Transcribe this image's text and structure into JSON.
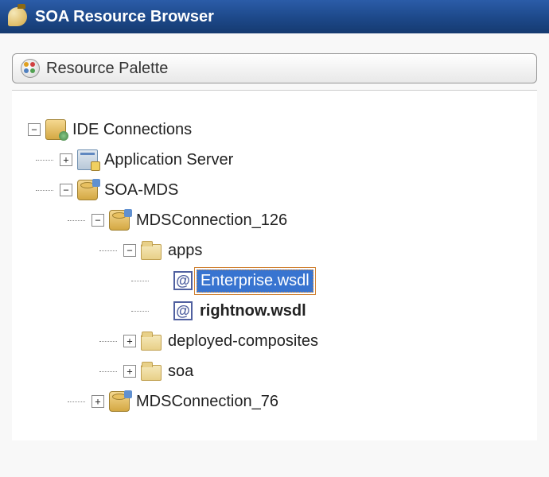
{
  "titlebar": {
    "title": "SOA Resource Browser"
  },
  "palette": {
    "label": "Resource Palette"
  },
  "tree": {
    "root": {
      "label": "IDE Connections",
      "children": [
        {
          "label": "Application Server"
        },
        {
          "label": "SOA-MDS",
          "children": [
            {
              "label": "MDSConnection_126",
              "children": [
                {
                  "label": "apps",
                  "children": [
                    {
                      "label": "Enterprise.wsdl"
                    },
                    {
                      "label": "rightnow.wsdl"
                    }
                  ]
                },
                {
                  "label": "deployed-composites"
                },
                {
                  "label": "soa"
                }
              ]
            },
            {
              "label": "MDSConnection_76"
            }
          ]
        }
      ]
    }
  }
}
